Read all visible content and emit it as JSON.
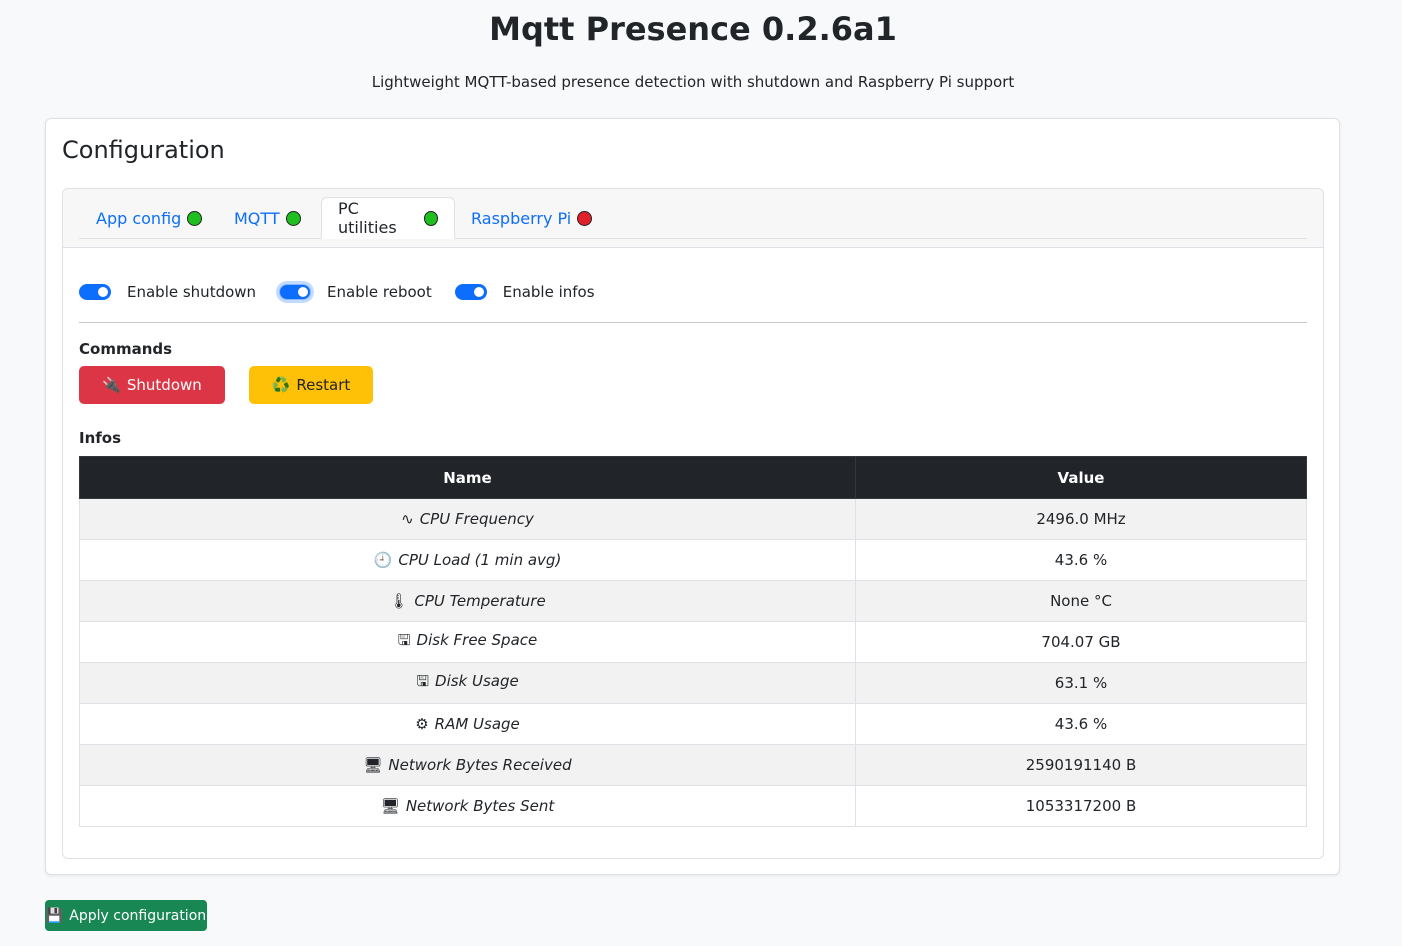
{
  "header": {
    "title": "Mqtt Presence 0.2.6a1",
    "subtitle": "Lightweight MQTT-based presence detection with shutdown and Raspberry Pi support"
  },
  "config": {
    "heading": "Configuration",
    "tabs": [
      {
        "label": "App config",
        "status": "ok",
        "status_color": "#1fbf1f"
      },
      {
        "label": "MQTT",
        "status": "ok",
        "status_color": "#1fbf1f"
      },
      {
        "label": "PC utilities",
        "status": "ok",
        "status_color": "#1fbf1f",
        "active": true
      },
      {
        "label": "Raspberry Pi",
        "status": "error",
        "status_color": "#e0202a"
      }
    ],
    "switches": [
      {
        "label": "Enable shutdown",
        "checked": true
      },
      {
        "label": "Enable reboot",
        "checked": true
      },
      {
        "label": "Enable infos",
        "checked": true
      }
    ],
    "commands": {
      "label": "Commands",
      "shutdown_label": "Shutdown",
      "shutdown_icon": "🔌",
      "restart_label": "Restart",
      "restart_icon": "♻️"
    },
    "infos": {
      "label": "Infos",
      "columns": [
        "Name",
        "Value"
      ],
      "rows": [
        {
          "icon": "∿",
          "name": "CPU Frequency",
          "value": "2496.0 MHz"
        },
        {
          "icon": "🕘",
          "name": "CPU Load (1 min avg)",
          "value": "43.6 %"
        },
        {
          "icon": "🌡",
          "name": "CPU Temperature",
          "value": "None °C"
        },
        {
          "icon": "🖫",
          "name": "Disk Free Space",
          "value": "704.07 GB"
        },
        {
          "icon": "🖫",
          "name": "Disk Usage",
          "value": "63.1 %"
        },
        {
          "icon": "⚙",
          "name": "RAM Usage",
          "value": "43.6 %"
        },
        {
          "icon": "🖥",
          "name": "Network Bytes Received",
          "value": "2590191140 B"
        },
        {
          "icon": "🖥",
          "name": "Network Bytes Sent",
          "value": "1053317200 B"
        }
      ]
    }
  },
  "footer": {
    "apply_label": "Apply configuration",
    "apply_icon": "💾"
  }
}
